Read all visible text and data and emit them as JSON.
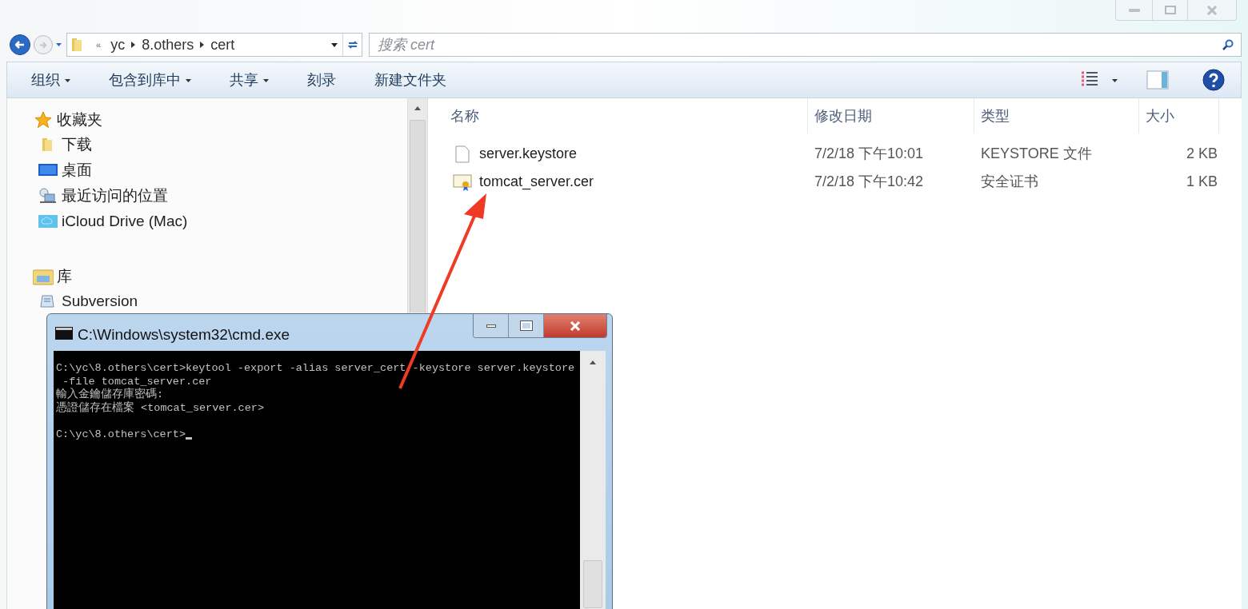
{
  "address_bar": {
    "path": [
      "yc",
      "8.others",
      "cert"
    ],
    "overflow_mark": "«"
  },
  "search": {
    "placeholder": "搜索 cert"
  },
  "toolbar": {
    "items": [
      {
        "label": "组织",
        "dropdown": true
      },
      {
        "label": "包含到库中",
        "dropdown": true
      },
      {
        "label": "共享",
        "dropdown": true
      },
      {
        "label": "刻录",
        "dropdown": false
      },
      {
        "label": "新建文件夹",
        "dropdown": false
      }
    ]
  },
  "sidebar": {
    "groups": [
      {
        "label": "收藏夹",
        "children": [
          "下载",
          "桌面",
          "最近访问的位置",
          "iCloud Drive (Mac)"
        ]
      },
      {
        "label": "库",
        "children": [
          "Subversion"
        ]
      }
    ]
  },
  "files": {
    "columns": [
      "名称",
      "修改日期",
      "类型",
      "大小"
    ],
    "rows": [
      {
        "name": "server.keystore",
        "date": "7/2/18 下午10:01",
        "type": "KEYSTORE 文件",
        "size": "2 KB"
      },
      {
        "name": "tomcat_server.cer",
        "date": "7/2/18 下午10:42",
        "type": "安全证书",
        "size": "1 KB"
      }
    ]
  },
  "cmd": {
    "title": "C:\\Windows\\system32\\cmd.exe",
    "lines": [
      "C:\\yc\\8.others\\cert>keytool -export -alias server_cert -keystore server.keystore",
      " -file tomcat_server.cer",
      "輸入金鑰儲存庫密碼:",
      "憑證儲存在檔案 <tomcat_server.cer>"
    ],
    "prompt": "C:\\yc\\8.others\\cert>"
  }
}
